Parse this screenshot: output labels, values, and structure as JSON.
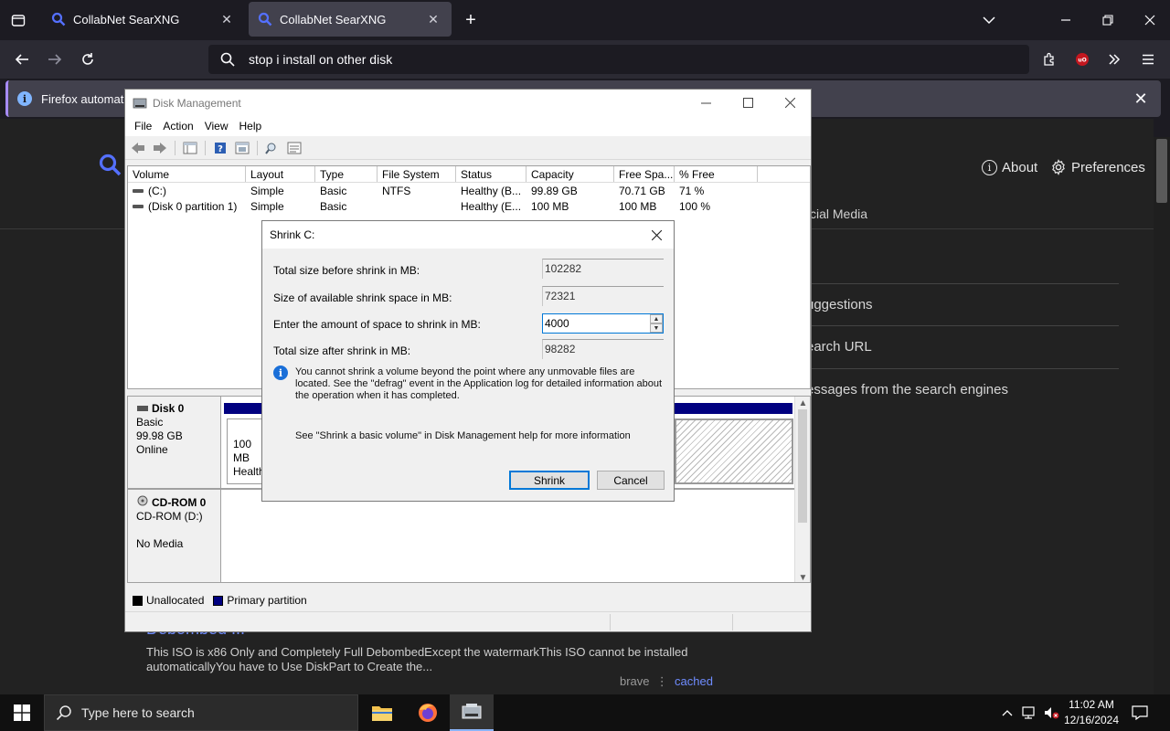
{
  "browser": {
    "tabs": [
      {
        "title": "CollabNet SearXNG",
        "active": false
      },
      {
        "title": "CollabNet SearXNG",
        "active": true
      }
    ],
    "address": "stop i install on other disk",
    "notification": "Firefox automatica",
    "accent": "#a78bfa"
  },
  "page": {
    "header_links": {
      "about": "About",
      "preferences": "Preferences"
    },
    "pref_tab": "cial Media",
    "pref_rows": [
      "uggestions",
      "earch URL",
      "essages from the search engines"
    ],
    "result": {
      "title": "Debombed ...",
      "description": "This ISO is x86 Only and Completely Full DebombedExcept the watermarkThis ISO cannot be installed automaticallyYou have to Use DiskPart to Create the...",
      "engine": "brave",
      "cached": "cached"
    }
  },
  "disk_mgmt": {
    "title": "Disk Management",
    "menu": [
      "File",
      "Action",
      "View",
      "Help"
    ],
    "columns": [
      "Volume",
      "Layout",
      "Type",
      "File System",
      "Status",
      "Capacity",
      "Free Spa...",
      "% Free"
    ],
    "volumes": [
      [
        "(C:)",
        "Simple",
        "Basic",
        "NTFS",
        "Healthy (B...",
        "99.89 GB",
        "70.71 GB",
        "71 %"
      ],
      [
        "(Disk 0 partition 1)",
        "Simple",
        "Basic",
        "",
        "Healthy (E...",
        "100 MB",
        "100 MB",
        "100 %"
      ]
    ],
    "disk0": {
      "name": "Disk 0",
      "type": "Basic",
      "size": "99.98 GB",
      "state": "Online",
      "part1_size": "100 MB",
      "part1_status": "Healthy"
    },
    "cdrom": {
      "name": "CD-ROM 0",
      "drive": "CD-ROM (D:)",
      "media": "No Media"
    },
    "legend": {
      "unallocated": "Unallocated",
      "primary": "Primary partition"
    },
    "primary_color": "#000080"
  },
  "shrink": {
    "title": "Shrink C:",
    "total_before_label": "Total size before shrink in MB:",
    "total_before": "102282",
    "available_label": "Size of available shrink space in MB:",
    "available": "72321",
    "amount_label": "Enter the amount of space to shrink in MB:",
    "amount": "4000",
    "total_after_label": "Total size after shrink in MB:",
    "total_after": "98282",
    "info": "You cannot shrink a volume beyond the point where any unmovable files are located. See the \"defrag\" event in the Application log for detailed information about the operation when it has completed.",
    "help": "See \"Shrink a basic volume\" in Disk Management help for more information",
    "ok_label": "Shrink",
    "cancel_label": "Cancel"
  },
  "taskbar": {
    "search_placeholder": "Type here to search",
    "time": "11:02 AM",
    "date": "12/16/2024"
  }
}
